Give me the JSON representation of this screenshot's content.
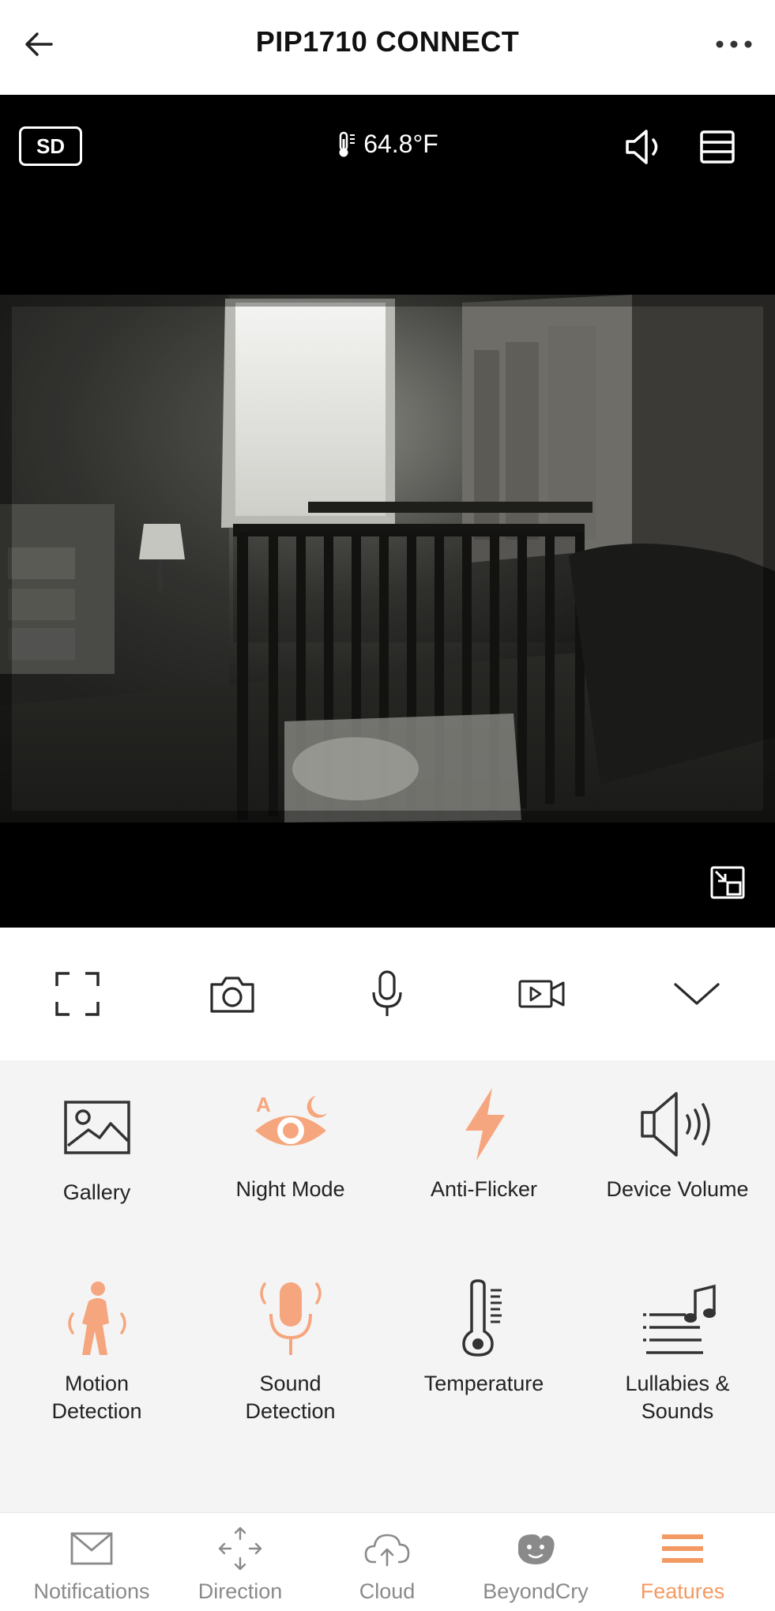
{
  "header": {
    "title": "PIP1710 CONNECT"
  },
  "video": {
    "quality_badge": "SD",
    "temperature": "64.8°F"
  },
  "features": [
    {
      "label": "Gallery",
      "icon": "gallery-icon"
    },
    {
      "label": "Night Mode",
      "icon": "night-mode-icon"
    },
    {
      "label": "Anti-Flicker",
      "icon": "anti-flicker-icon"
    },
    {
      "label": "Device Volume",
      "icon": "device-volume-icon"
    },
    {
      "label": "Motion\nDetection",
      "icon": "motion-detection-icon"
    },
    {
      "label": "Sound\nDetection",
      "icon": "sound-detection-icon"
    },
    {
      "label": "Temperature",
      "icon": "temperature-icon"
    },
    {
      "label": "Lullabies &\nSounds",
      "icon": "lullabies-icon"
    }
  ],
  "bottom_nav": [
    {
      "label": "Notifications",
      "icon": "envelope-icon"
    },
    {
      "label": "Direction",
      "icon": "direction-arrows-icon"
    },
    {
      "label": "Cloud",
      "icon": "cloud-upload-icon"
    },
    {
      "label": "BeyondCry",
      "icon": "baby-face-icon"
    },
    {
      "label": "Features",
      "icon": "features-menu-icon",
      "active": true
    }
  ],
  "colors": {
    "accent": "#f39a63",
    "icon_orange": "#f6a67e",
    "features_bg": "#f4f4f4"
  }
}
